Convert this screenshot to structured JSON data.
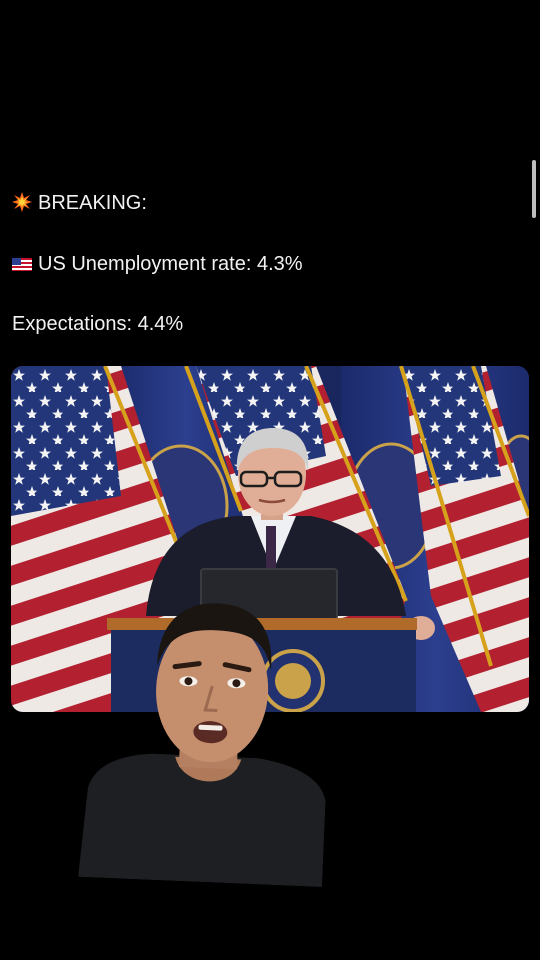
{
  "post": {
    "lines": [
      {
        "icon": "collision-icon",
        "text": "BREAKING:"
      },
      {
        "icon": "us-flag-icon",
        "text": "US Unemployment rate: 4.3%"
      },
      {
        "icon": "",
        "text": "Expectations: 4.4%"
      }
    ]
  },
  "colors": {
    "background": "#000000",
    "text": "#f2f2f2",
    "flag_blue": "#23367a",
    "flag_red": "#b3202f",
    "fringe_gold": "#d6a21c",
    "podium": "#1c2b60"
  },
  "media": {
    "photo": "press-conference-photo",
    "overlay": "greenscreen-webcam"
  }
}
